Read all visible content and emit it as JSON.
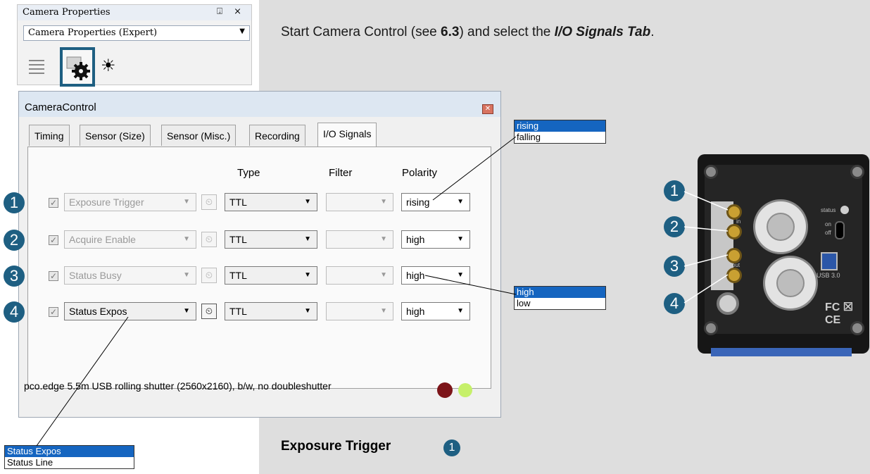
{
  "camera_properties": {
    "title": "Camera Properties",
    "title_icons": "⍗ ×",
    "mode_selected": "Camera Properties (Expert)"
  },
  "intro": {
    "prefix": "Start Camera Control (see ",
    "ref": "6.3",
    "middle": ") and select the ",
    "tab_name": "I/O Signals Tab",
    "suffix": "."
  },
  "camera_control": {
    "title": "CameraControl",
    "tabs": [
      "Timing",
      "Sensor (Size)",
      "Sensor (Misc.)",
      "Recording",
      "I/O Signals"
    ],
    "active_tab": "I/O Signals",
    "column_headers": {
      "type": "Type",
      "filter": "Filter",
      "polarity": "Polarity"
    },
    "rows": [
      {
        "badge": "1",
        "checked": "✓",
        "signal": "Exposure Trigger",
        "type": "TTL",
        "filter": "",
        "polarity": "rising"
      },
      {
        "badge": "2",
        "checked": "✓",
        "signal": "Acquire Enable",
        "type": "TTL",
        "filter": "",
        "polarity": "high"
      },
      {
        "badge": "3",
        "checked": "✓",
        "signal": "Status Busy",
        "type": "TTL",
        "filter": "",
        "polarity": "high"
      },
      {
        "badge": "4",
        "checked": "✓",
        "signal": "Status Expos",
        "type": "TTL",
        "filter": "",
        "polarity": "high"
      }
    ],
    "status_text": "pco.edge 5.5m USB rolling shutter (2560x2160), b/w, no doubleshutter"
  },
  "popups": {
    "polarity_edge": [
      "rising",
      "falling"
    ],
    "polarity_level": [
      "high",
      "low"
    ],
    "status_signal": [
      "Status Expos",
      "Status Line"
    ]
  },
  "camera_photo": {
    "badges": [
      "1",
      "2",
      "3",
      "4"
    ],
    "labels": {
      "in": "in",
      "out": "out",
      "status": "status",
      "on": "on",
      "off": "off",
      "usb": "USB 3.0",
      "fc": "FC ☒ CE"
    }
  },
  "section": {
    "heading": "Exposure Trigger",
    "badge": "1"
  },
  "colors": {
    "accent": "#1e5f82",
    "highlight": "#1565c0",
    "page_bg": "#dedede",
    "led_red": "#7c1419",
    "led_green": "#c6f06a"
  }
}
